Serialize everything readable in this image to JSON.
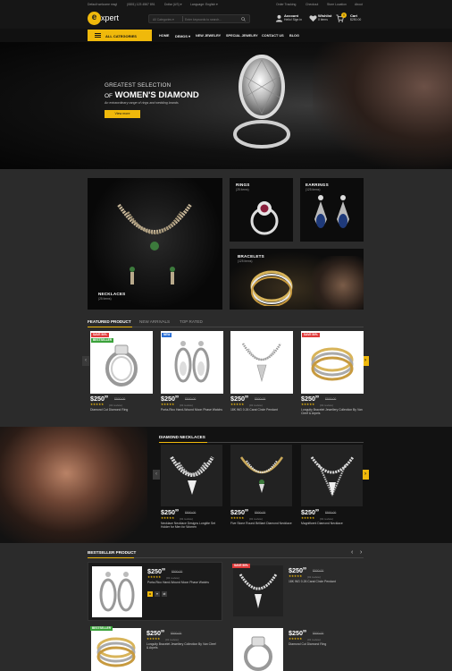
{
  "topbar": {
    "welcome": "Default welcome msg!",
    "phone": "(0801) 123 4567 891",
    "currency": "Dollar (US) ▾",
    "language": "Language: English ▾",
    "links": [
      "Order Tracking",
      "Checkout",
      "Store Location",
      "About"
    ]
  },
  "header": {
    "logo_letter": "e",
    "logo_text": "xpert",
    "search_category": "All Categories ▾",
    "search_placeholder": "Enter keywords to search...",
    "account_title": "Account",
    "account_sub": "Hello! Sign in",
    "wishlist_title": "Wishlist",
    "wishlist_sub": "0 items",
    "cart_title": "Cart",
    "cart_sub": "$250.00",
    "cart_count": "0"
  },
  "nav": {
    "all_categories": "ALL CATEGORIES",
    "items": [
      "HOME",
      "DEMOS ▾",
      "NEW JEWELRY",
      "SPECIAL JEWELRY",
      "CONTACT US",
      "BLOG"
    ]
  },
  "hero": {
    "sub": "GREATEST SELECTION",
    "of": "OF",
    "title": "WOMEN'S DIAMOND",
    "desc": "An extraordinary range of rings and wedding brands",
    "button": "View more"
  },
  "banners": [
    {
      "title": "NECKLACES",
      "count": "(25 items)"
    },
    {
      "title": "RINGS",
      "count": "(25 items)"
    },
    {
      "title": "EARRINGS",
      "count": "(125 items)"
    },
    {
      "title": "BRACELETS",
      "count": "(125 items)"
    }
  ],
  "featured": {
    "tabs": [
      "FEATURED PRODUCT",
      "NEW ARRIVALS",
      "TOP RATED"
    ],
    "products": [
      {
        "label": "SAVE 50%",
        "label2": "BESTSELLER",
        "price": "$250",
        "cents": "99",
        "old": "$500.00",
        "stars": "★★★★★",
        "reviews": "(01 review)",
        "name": "Diamond Cut Diamond Ring"
      },
      {
        "label": "NEW",
        "label2": "",
        "price": "$250",
        "cents": "99",
        "old": "$500.00",
        "stars": "★★★★★",
        "reviews": "(01 review)",
        "name": "Porta-Rico Hand-Wound Moon Phase Watchs"
      },
      {
        "label": "",
        "label2": "",
        "price": "$250",
        "cents": "99",
        "old": "$500.00",
        "stars": "★★★★★",
        "reviews": "(01 review)",
        "name": "18K WG 0.26 Carat Circle Pendant"
      },
      {
        "label": "SAVE 50%",
        "label2": "",
        "price": "$250",
        "cents": "99",
        "old": "$500.00",
        "stars": "★★★★★",
        "reviews": "(01 review)",
        "name": "Longuity Bracelet Jewellery Collection By Van Cleef & Arpels"
      }
    ]
  },
  "diamond": {
    "title": "DIAMOND NECKLACES",
    "products": [
      {
        "price": "$250",
        "cents": "99",
        "old": "$500.00",
        "stars": "★★★★★",
        "reviews": "(01 review)",
        "name": "Necklace Necklace Designs Longitte Set Holder for Men for Women"
      },
      {
        "price": "$250",
        "cents": "99",
        "old": "$500.00",
        "stars": "★★★★★",
        "reviews": "(01 review)",
        "name": "Five Stone Round Brilliant Diamond Necklace"
      },
      {
        "price": "$250",
        "cents": "99",
        "old": "$500.00",
        "stars": "★★★★★",
        "reviews": "(01 review)",
        "name": "Magnificent Diamond Necklace"
      }
    ]
  },
  "bestseller": {
    "title": "BESTSELLER PRODUCT",
    "products": [
      {
        "label": "",
        "price": "$250",
        "cents": "99",
        "old": "$500.00",
        "stars": "★★★★★",
        "reviews": "(01 review)",
        "name": "Porta-Rico Hand-Wound Moon Phase Watchs"
      },
      {
        "label": "SAVE 50%",
        "price": "$250",
        "cents": "99",
        "old": "$500.00",
        "stars": "★★★★★",
        "reviews": "(01 review)",
        "name": "18K WG 0.26 Carat Circle Pendant"
      },
      {
        "label": "BESTSELLER",
        "price": "$250",
        "cents": "99",
        "old": "$500.00",
        "stars": "★★★★★",
        "reviews": "(01 review)",
        "name": "Longuity Bracelet Jewellery Collection By Van Cleef & Arpels"
      },
      {
        "label": "",
        "price": "$250",
        "cents": "99",
        "old": "$500.00",
        "stars": "★★★★★",
        "reviews": "(01 review)",
        "name": "Diamond Cut Diamond Ring"
      }
    ]
  },
  "colors": {
    "accent": "#f0b90b",
    "sale": "#e03a3a",
    "new": "#2a6fd6",
    "bestseller": "#3aa23a"
  }
}
